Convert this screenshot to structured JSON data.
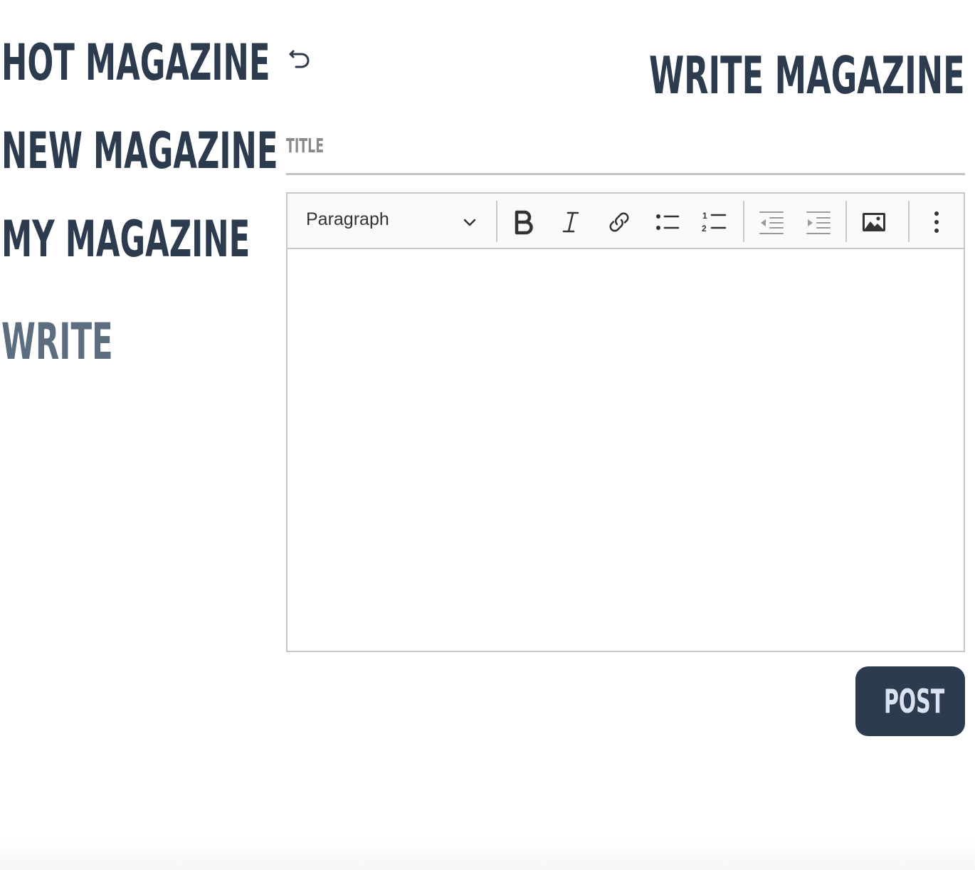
{
  "nav": {
    "items": [
      {
        "label": "HOT MAGAZINE"
      },
      {
        "label": "NEW MAGAZINE"
      },
      {
        "label": "MY MAGAZINE"
      },
      {
        "label": "WRITE"
      }
    ]
  },
  "header": {
    "title": "WRITE MAGAZINE",
    "back_icon": "undo-arrow-icon"
  },
  "form": {
    "title_placeholder": "TITLE",
    "title_value": ""
  },
  "editor": {
    "block_format": "Paragraph",
    "toolbar_icons": [
      "bold-icon",
      "italic-icon",
      "link-icon",
      "bulleted-list-icon",
      "numbered-list-icon",
      "outdent-icon",
      "indent-icon",
      "image-icon",
      "more-vertical-icon"
    ],
    "content": ""
  },
  "actions": {
    "post_label": "POST"
  },
  "colors": {
    "primary": "#2d3b4f",
    "active_nav": "#5d6d80",
    "button_text": "#d9e2ee",
    "border": "#c8c8c8",
    "placeholder": "#8a8a8a"
  }
}
